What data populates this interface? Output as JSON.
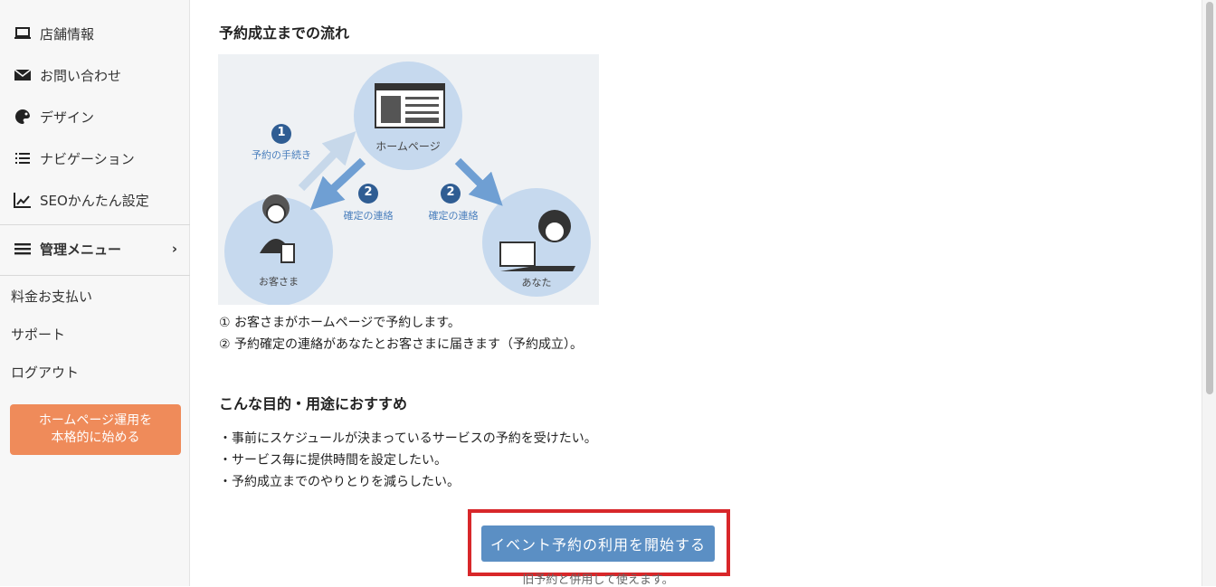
{
  "sidebar": {
    "items": [
      {
        "label": "店舗情報",
        "icon": "laptop-icon"
      },
      {
        "label": "お問い合わせ",
        "icon": "envelope-icon"
      },
      {
        "label": "デザイン",
        "icon": "palette-icon"
      },
      {
        "label": "ナビゲーション",
        "icon": "list-icon"
      },
      {
        "label": "SEOかんたん設定",
        "icon": "chart-line-icon"
      }
    ],
    "admin_menu": {
      "label": "管理メニュー",
      "icon": "hamburger-icon",
      "chevron": "›"
    },
    "links": [
      "料金お支払い",
      "サポート",
      "ログアウト"
    ],
    "cta": "ホームページ運用を\n本格的に始める"
  },
  "main": {
    "flow_heading": "予約成立までの流れ",
    "illustration": {
      "homepage_label": "ホームページ",
      "customer_label": "お客さま",
      "you_label": "あなた",
      "step1_number": "1",
      "step1_label": "予約の手続き",
      "step2_number": "2",
      "step2_left_label": "確定の連絡",
      "step2_right_label": "確定の連絡"
    },
    "flow_steps": [
      "① お客さまがホームページで予約します。",
      "② 予約確定の連絡があなたとお客さまに届きます（予約成立）。"
    ],
    "purpose_heading": "こんな目的・用途におすすめ",
    "purposes": [
      "・事前にスケジュールが決まっているサービスの予約を受けたい。",
      "・サービス毎に提供時間を設定したい。",
      "・予約成立までのやりとりを減らしたい。"
    ],
    "start_button": "イベント予約の利用を開始する",
    "note": "旧予約と併用して使えます。"
  },
  "colors": {
    "accent_orange": "#ef8b5a",
    "button_blue": "#5b8fc4",
    "highlight_red": "#d8272a",
    "illustration_blue": "#6f9fd3"
  }
}
